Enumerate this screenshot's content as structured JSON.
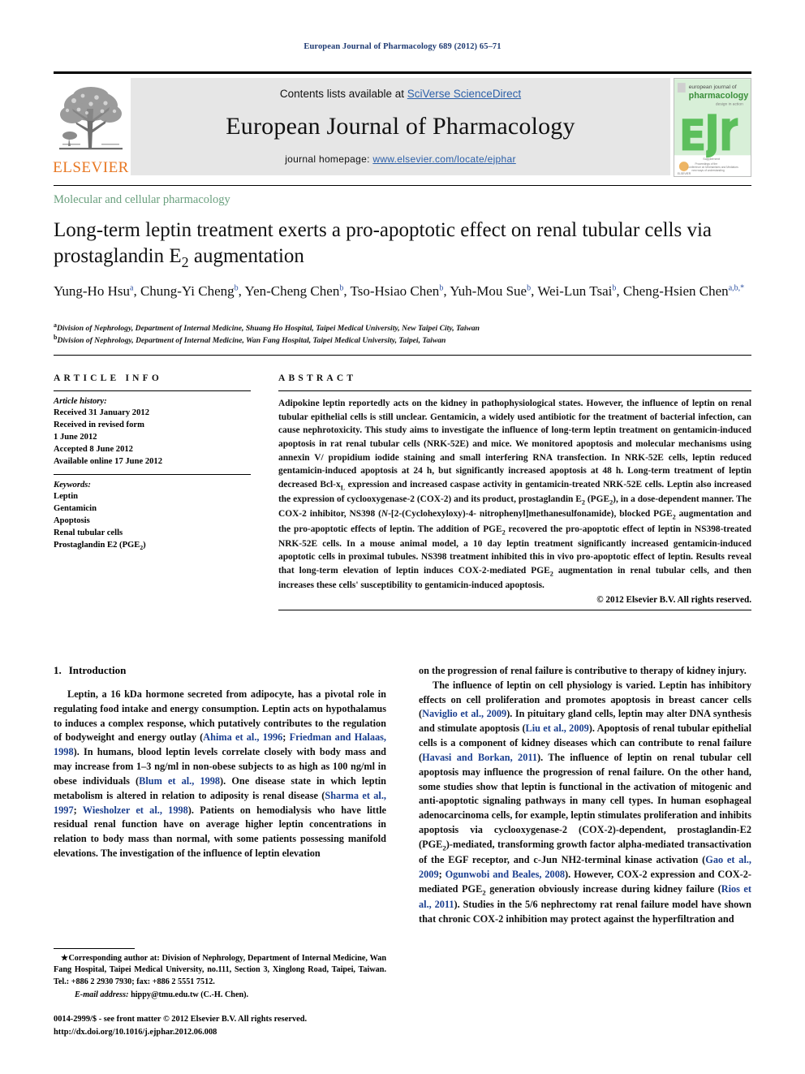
{
  "running_head": "European Journal of Pharmacology 689 (2012) 65–71",
  "masthead": {
    "elsevier_wordmark": "ELSEVIER",
    "contents_prefix": "Contents lists available at ",
    "contents_link": "SciVerse ScienceDirect",
    "journal_title": "European Journal of Pharmacology",
    "homepage_prefix": "journal homepage: ",
    "homepage_link": "www.elsevier.com/locate/ejphar",
    "cover_title_line1": "european journal of",
    "cover_title_line2": "pharmacology",
    "cover_monogram": "ejp"
  },
  "article": {
    "subject_section": "Molecular and cellular pharmacology",
    "title_line1": "Long-term leptin treatment exerts a pro-apoptotic effect on renal tubular",
    "title_line2_a": "cells via prostaglandin E",
    "title_line2_sub": "2",
    "title_line2_b": " augmentation",
    "authors_line1": "Yung-Ho Hsu",
    "authors": [
      {
        "name": "Yung-Ho Hsu",
        "sup": "a"
      },
      {
        "name": "Chung-Yi Cheng",
        "sup": "b"
      },
      {
        "name": "Yen-Cheng Chen",
        "sup": "b"
      },
      {
        "name": "Tso-Hsiao Chen",
        "sup": "b"
      },
      {
        "name": "Yuh-Mou Sue",
        "sup": "b"
      },
      {
        "name": "Wei-Lun Tsai",
        "sup": "b"
      },
      {
        "name": "Cheng-Hsien Chen",
        "sup": "a,b,*"
      }
    ],
    "affiliations": [
      {
        "mark": "a",
        "text": "Division of Nephrology, Department of Internal Medicine, Shuang Ho Hospital, Taipei Medical University, New Taipei City, Taiwan"
      },
      {
        "mark": "b",
        "text": "Division of Nephrology, Department of Internal Medicine, Wan Fang Hospital, Taipei Medical University, Taipei, Taiwan"
      }
    ]
  },
  "article_info": {
    "heading": "ARTICLE INFO",
    "history_label": "Article history:",
    "history": [
      "Received 31 January 2012",
      "Received in revised form",
      "1 June 2012",
      "Accepted 8 June 2012",
      "Available online 17 June 2012"
    ],
    "keywords_label": "Keywords:",
    "keywords": [
      "Leptin",
      "Gentamicin",
      "Apoptosis",
      "Renal tubular cells",
      "Prostaglandin E2 (PGE2)"
    ]
  },
  "abstract": {
    "heading": "ABSTRACT",
    "text": "Adipokine leptin reportedly acts on the kidney in pathophysiological states. However, the influence of leptin on renal tubular epithelial cells is still unclear. Gentamicin, a widely used antibiotic for the treatment of bacterial infection, can cause nephrotoxicity. This study aims to investigate the influence of long-term leptin treatment on gentamicin-induced apoptosis in rat renal tubular cells (NRK-52E) and mice. We monitored apoptosis and molecular mechanisms using annexin V/ propidium iodide staining and small interfering RNA transfection. In NRK-52E cells, leptin reduced gentamicin-induced apoptosis at 24 h, but significantly increased apoptosis at 48 h. Long-term treatment of leptin decreased Bcl-xL expression and increased caspase activity in gentamicin-treated NRK-52E cells. Leptin also increased the expression of cyclooxygenase-2 (COX-2) and its product, prostaglandin E2 (PGE2), in a dose-dependent manner. The COX-2 inhibitor, NS398 (N-[2-(Cyclohexyloxy)-4- nitrophenyl]methanesulfonamide), blocked PGE2 augmentation and the pro-apoptotic effects of leptin. The addition of PGE2 recovered the pro-apoptotic effect of leptin in NS398-treated NRK-52E cells. In a mouse animal model, a 10 day leptin treatment significantly increased gentamicin-induced apoptotic cells in proximal tubules. NS398 treatment inhibited this in vivo pro-apoptotic effect of leptin. Results reveal that long-term elevation of leptin induces COX-2-mediated PGE2 augmentation in renal tubular cells, and then increases these cells' susceptibility to gentamicin-induced apoptosis.",
    "copyright": "© 2012 Elsevier B.V. All rights reserved."
  },
  "introduction": {
    "number": "1.",
    "title": "Introduction",
    "left_paragraph": "Leptin, a 16 kDa hormone secreted from adipocyte, has a pivotal role in regulating food intake and energy consumption. Leptin acts on hypothalamus to induces a complex response, which putatively contributes to the regulation of bodyweight and energy outlay (Ahima et al., 1996; Friedman and Halaas, 1998). In humans, blood leptin levels correlate closely with body mass and may increase from 1–3 ng/ml in non-obese subjects to as high as 100 ng/ml in obese individuals (Blum et al., 1998). One disease state in which leptin metabolism is altered in relation to adiposity is renal disease (Sharma et al., 1997; Wiesholzer et al., 1998). Patients on hemodialysis who have little residual renal function have on average higher leptin concentrations in relation to body mass than normal, with some patients possessing manifold elevations. The investigation of the influence of leptin elevation",
    "right_paragraph_tail": "on the progression of renal failure is contributive to therapy of kidney injury.",
    "right_paragraph": "The influence of leptin on cell physiology is varied. Leptin has inhibitory effects on cell proliferation and promotes apoptosis in breast cancer cells (Naviglio et al., 2009). In pituitary gland cells, leptin may alter DNA synthesis and stimulate apoptosis (Liu et al., 2009). Apoptosis of renal tubular epithelial cells is a component of kidney diseases which can contribute to renal failure (Havasi and Borkan, 2011). The influence of leptin on renal tubular cell apoptosis may influence the progression of renal failure. On the other hand, some studies show that leptin is functional in the activation of mitogenic and anti-apoptotic signaling pathways in many cell types. In human esophageal adenocarcinoma cells, for example, leptin stimulates proliferation and inhibits apoptosis via cyclooxygenase-2 (COX-2)-dependent, prostaglandin-E2 (PGE2)-mediated, transforming growth factor alpha-mediated transactivation of the EGF receptor, and c-Jun NH2-terminal kinase activation (Gao et al., 2009; Ogunwobi and Beales, 2008). However, COX-2 expression and COX-2-mediated PGE2 generation obviously increase during kidney failure (Rios et al., 2011). Studies in the 5/6 nephrectomy rat renal failure model have shown that chronic COX-2 inhibition may protect against the hyperfiltration and"
  },
  "footnotes": {
    "corresponding": "Corresponding author at: Division of Nephrology, Department of Internal Medicine, Wan Fang Hospital, Taipei Medical University, no.111, Section 3, Xinglong Road, Taipei, Taiwan. Tel.: +886 2 2930 7930; fax: +886 2 5551 7512.",
    "email_label": "E-mail address:",
    "email_value": "hippy@tmu.edu.tw (C.-H. Chen)."
  },
  "imprint": {
    "issn_line": "0014-2999/$ - see front matter © 2012 Elsevier B.V. All rights reserved.",
    "doi_line": "http://dx.doi.org/10.1016/j.ejphar.2012.06.008"
  },
  "colors": {
    "running_head": "#1f3b73",
    "subject_section": "#6aa07e",
    "link": "#2b5fa8",
    "citation": "#1b3f8f",
    "elsevier_orange": "#e87722",
    "band_gray": "#e6e6e6"
  }
}
